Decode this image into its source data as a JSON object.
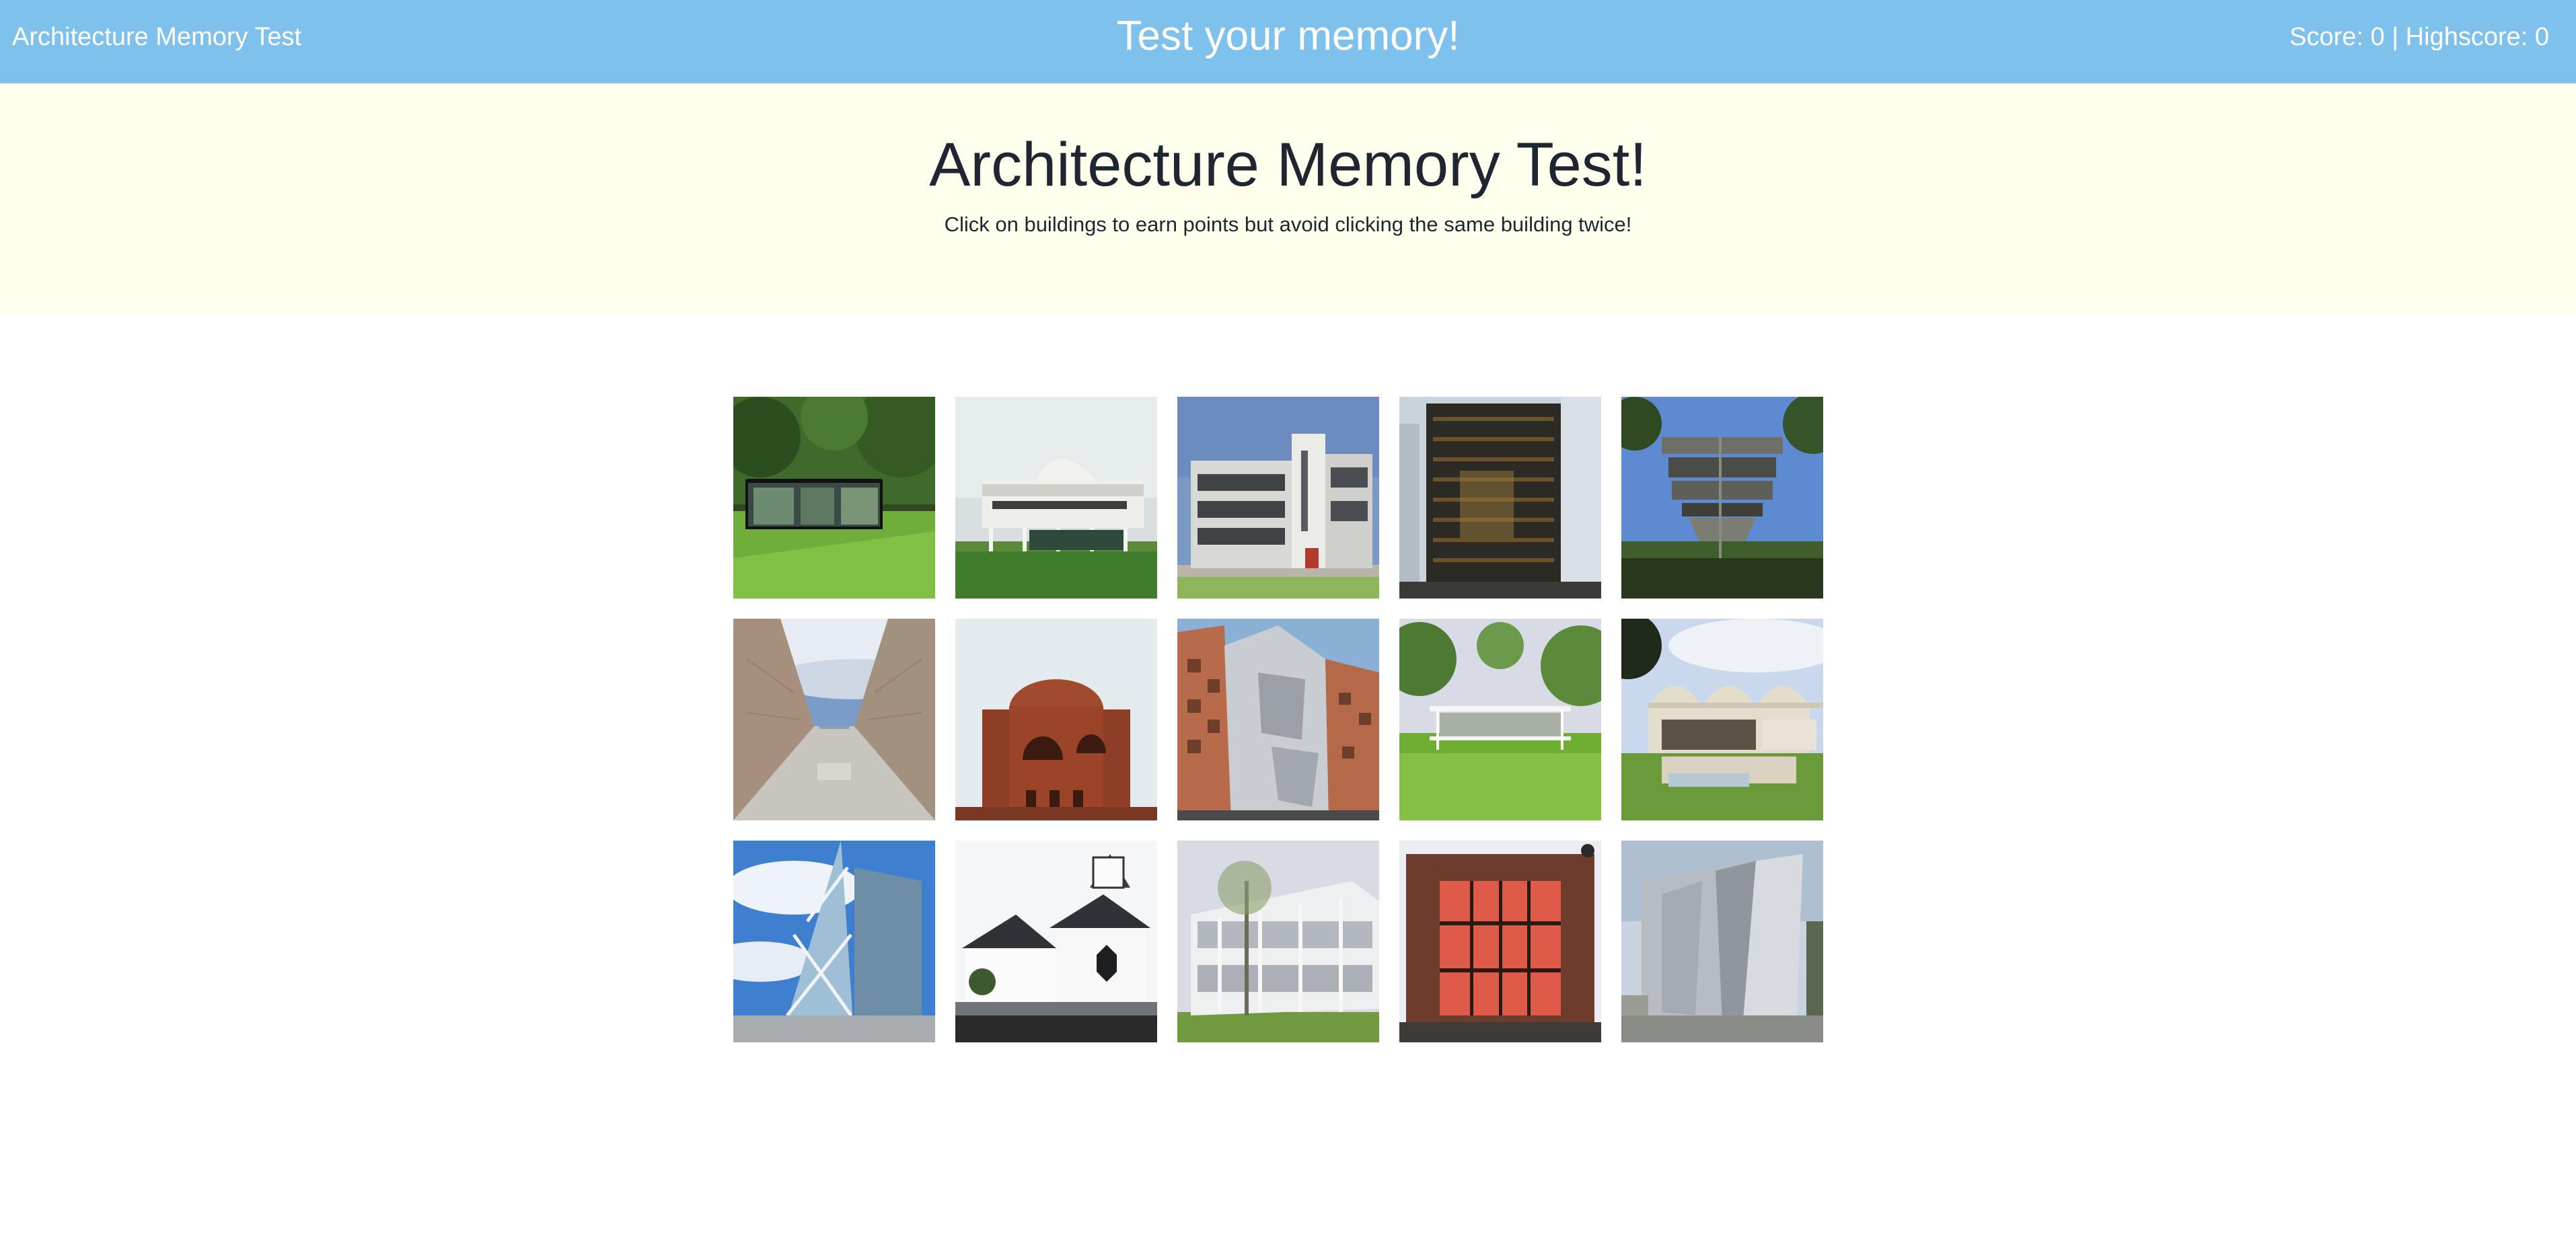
{
  "navbar": {
    "brand": "Architecture Memory Test",
    "center_title": "Test your memory!",
    "score_text": "Score: 0 | Highscore: 0",
    "background": "#7fc1ed"
  },
  "jumbotron": {
    "title": "Architecture Memory Test!",
    "subtitle": "Click on buildings to earn points but avoid clicking the same building twice!",
    "background": "#ffffee"
  },
  "cards": [
    {
      "depicts": "glass house in forest clearing"
    },
    {
      "depicts": "white villa on pilotis"
    },
    {
      "depicts": "bauhaus building with vertical sign"
    },
    {
      "depicts": "dark glass skyscraper"
    },
    {
      "depicts": "brutalist library with trees"
    },
    {
      "depicts": "concrete courtyard under cloudy sky"
    },
    {
      "depicts": "red brick cylindrical building"
    },
    {
      "depicts": "deconstructivist metal and brick building"
    },
    {
      "depicts": "glass pavilion on lawn"
    },
    {
      "depicts": "vaulted concrete museum"
    },
    {
      "depicts": "glass tower with diagonal bracing"
    },
    {
      "depicts": "white museum with geometric roofs"
    },
    {
      "depicts": "white modernist house behind tree"
    },
    {
      "depicts": "brick facade with red-lit glass"
    },
    {
      "depicts": "angular metallic building"
    }
  ]
}
